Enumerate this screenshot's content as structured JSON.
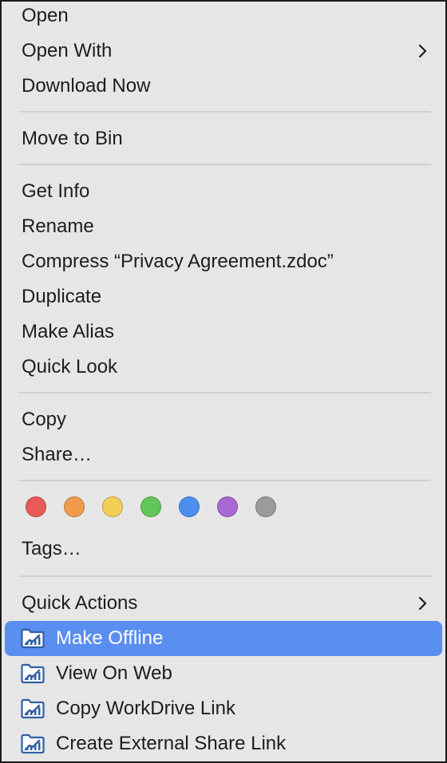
{
  "menu": {
    "open": "Open",
    "open_with": "Open With",
    "download_now": "Download Now",
    "move_to_bin": "Move to Bin",
    "get_info": "Get Info",
    "rename": "Rename",
    "compress": "Compress “Privacy Agreement.zdoc”",
    "duplicate": "Duplicate",
    "make_alias": "Make Alias",
    "quick_look": "Quick Look",
    "copy": "Copy",
    "share": "Share…",
    "tags": "Tags…",
    "quick_actions": "Quick Actions",
    "make_offline": "Make Offline",
    "view_on_web": "View On Web",
    "copy_workdrive_link": "Copy WorkDrive Link",
    "create_external_share_link": "Create External Share Link"
  },
  "tag_colors": [
    {
      "name": "red",
      "color": "#e85a58"
    },
    {
      "name": "orange",
      "color": "#ee9c4c"
    },
    {
      "name": "yellow",
      "color": "#f2d057"
    },
    {
      "name": "green",
      "color": "#62c55b"
    },
    {
      "name": "blue",
      "color": "#4c8ef0"
    },
    {
      "name": "purple",
      "color": "#a868d4"
    },
    {
      "name": "gray",
      "color": "#9b9b9b"
    }
  ],
  "colors": {
    "highlight": "#5a8ef0",
    "workdrive_icon": "#2f5fa3"
  },
  "highlighted_item": "make_offline"
}
